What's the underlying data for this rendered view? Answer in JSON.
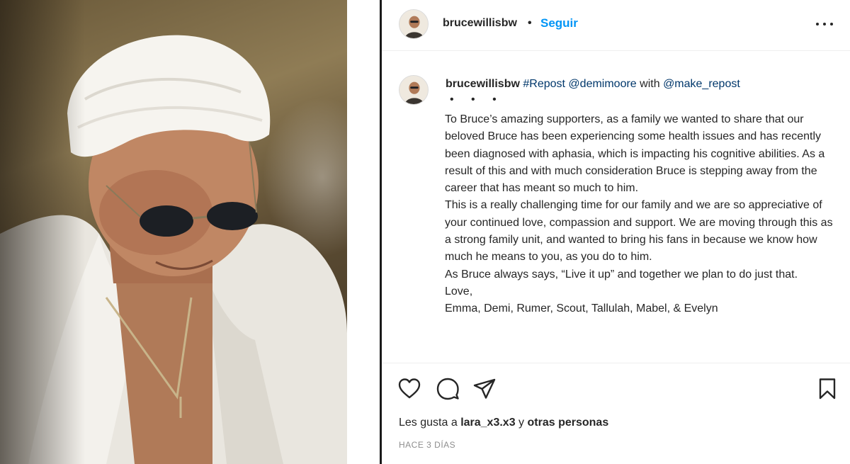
{
  "post": {
    "username": "brucewillisbw",
    "separator": "•",
    "follow_label": "Seguir",
    "more_icon": "more-horizontal-icon"
  },
  "photo": {
    "description_icon": "post-photo"
  },
  "caption": {
    "username": "brucewillisbw",
    "repost_tag": "#Repost",
    "mention_1": "@demimoore",
    "with_text": "with",
    "mention_2": "@make_repost",
    "dots": "• • •",
    "paragraphs": [
      "To Bruce’s amazing supporters, as a family we wanted to share that our beloved Bruce has been experiencing some health issues and has recently been diagnosed with aphasia, which is impacting his cognitive abilities. As a result of this and with much consideration Bruce is stepping away from the career that has meant so much to him.",
      "This is a really challenging time for our family and we are so appreciative of your continued love, compassion and support. We are moving through this as a strong family unit, and wanted to bring his fans in because we know how much he means to you, as you do to him.",
      "As Bruce always says, “Live it up” and together we plan to do just that.",
      "Love,",
      "Emma, Demi, Rumer, Scout, Tallulah, Mabel, & Evelyn"
    ]
  },
  "actions": {
    "like_icon": "heart-icon",
    "comment_icon": "comment-icon",
    "share_icon": "paper-plane-icon",
    "save_icon": "bookmark-icon"
  },
  "likes": {
    "prefix": "Les gusta a",
    "user": "lara_x3.x3",
    "connector": "y",
    "others": "otras personas"
  },
  "time_ago": "HACE 3 DÍAS"
}
